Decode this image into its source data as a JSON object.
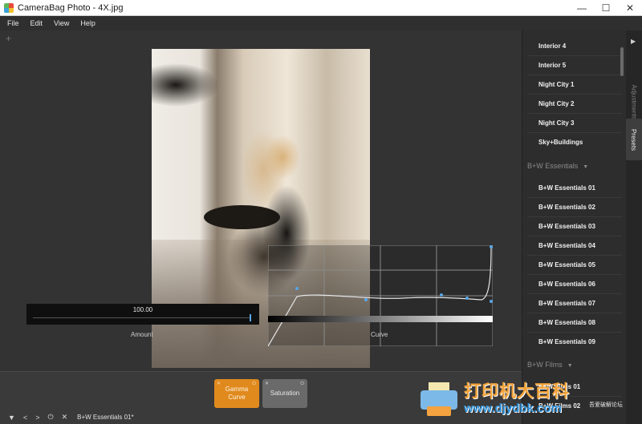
{
  "window": {
    "title": "CameraBag Photo - 4X.jpg",
    "minimize": "—",
    "maximize": "☐",
    "close": "✕"
  },
  "menu": [
    "File",
    "Edit",
    "View",
    "Help"
  ],
  "canvas": {
    "add_tab": "+"
  },
  "adjustment": {
    "amount_value": "100.00",
    "amount_fraction": 1.0,
    "amount_label": "Amount",
    "curve_label": "Curve"
  },
  "presets": {
    "group_top_items": [
      "Interior 4",
      "Interior 5",
      "Night City 1",
      "Night City 2",
      "Night City 3",
      "Sky+Buildings"
    ],
    "group_bw_essentials": {
      "title": "B+W Essentials",
      "items": [
        "B+W Essentials 01",
        "B+W Essentials 02",
        "B+W Essentials 03",
        "B+W Essentials 04",
        "B+W Essentials 05",
        "B+W Essentials 06",
        "B+W Essentials 07",
        "B+W Essentials 08",
        "B+W Essentials 09"
      ]
    },
    "group_bw_films": {
      "title": "B+W Films",
      "items": [
        "B+W Films 01",
        "B+W Films 02"
      ]
    },
    "caret": "▼"
  },
  "side_tabs": {
    "arrow": "▶",
    "adjustments": "Adjustments",
    "presets": "Presets"
  },
  "tiles": [
    {
      "label_line1": "Gamma",
      "label_line2": "Curve",
      "active": true
    },
    {
      "label_line1": "Saturation",
      "label_line2": "",
      "active": false
    }
  ],
  "tile_icons": {
    "close": "✕",
    "toggle": "⏻"
  },
  "bottom_controls": {
    "menu_toggle": "▼",
    "prev": "<",
    "next": ">",
    "power": "⏻",
    "close": "✕",
    "history_label": "B+W Essentials 01*"
  },
  "watermark": {
    "title": "打印机大百科",
    "url": "www.djydbk.com",
    "small": "吾爱破解论坛"
  },
  "colors": {
    "accent_orange": "#e08a1e",
    "slider_blue": "#58a6e6",
    "panel_bg": "#2d2d2d"
  }
}
